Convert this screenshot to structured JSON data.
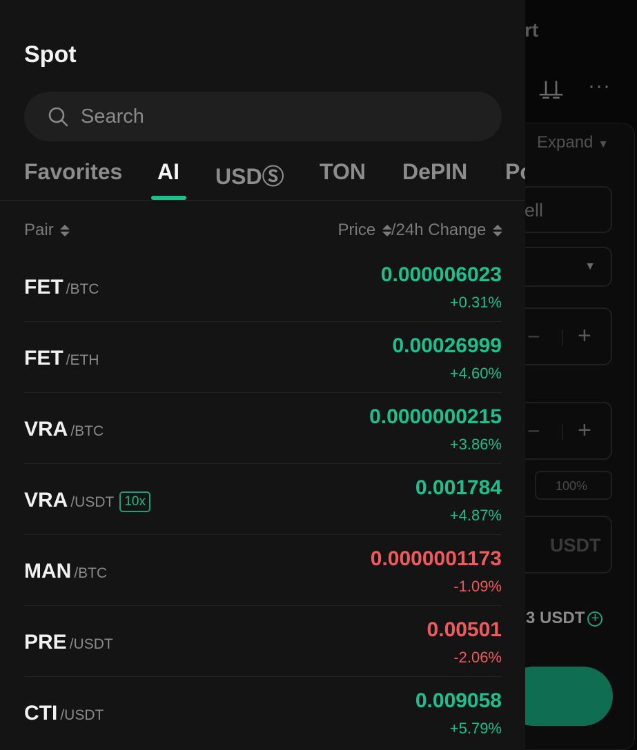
{
  "background": {
    "title_fragment": "rt",
    "expand_label": "Expand",
    "sell_fragment": "ell",
    "percent_label": "100%",
    "amount_unit": "USDT",
    "balance_text": "3  USDT"
  },
  "drawer": {
    "title": "Spot",
    "search_placeholder": "Search",
    "tabs": [
      {
        "label": "Favorites",
        "active": false
      },
      {
        "label": "AI",
        "active": true
      },
      {
        "label": "USDⓈ",
        "active": false
      },
      {
        "label": "TON",
        "active": false
      },
      {
        "label": "DePIN",
        "active": false
      },
      {
        "label": "Po",
        "active": false
      }
    ],
    "columns": {
      "pair": "Pair",
      "price": "Price",
      "change": "/24h Change"
    },
    "pairs": [
      {
        "base": "FET",
        "quote": "/BTC",
        "badge": "",
        "price": "0.000006023",
        "change": "+0.31%",
        "trend": "up"
      },
      {
        "base": "FET",
        "quote": "/ETH",
        "badge": "",
        "price": "0.00026999",
        "change": "+4.60%",
        "trend": "up"
      },
      {
        "base": "VRA",
        "quote": "/BTC",
        "badge": "",
        "price": "0.0000000215",
        "change": "+3.86%",
        "trend": "up"
      },
      {
        "base": "VRA",
        "quote": "/USDT",
        "badge": "10x",
        "price": "0.001784",
        "change": "+4.87%",
        "trend": "up"
      },
      {
        "base": "MAN",
        "quote": "/BTC",
        "badge": "",
        "price": "0.0000001173",
        "change": "-1.09%",
        "trend": "down"
      },
      {
        "base": "PRE",
        "quote": "/USDT",
        "badge": "",
        "price": "0.00501",
        "change": "-2.06%",
        "trend": "down"
      },
      {
        "base": "CTI",
        "quote": "/USDT",
        "badge": "",
        "price": "0.009058",
        "change": "+5.79%",
        "trend": "up"
      }
    ]
  },
  "colors": {
    "up": "#1dbf8b",
    "down": "#ef5a5c",
    "accent": "#1dbf8b"
  }
}
